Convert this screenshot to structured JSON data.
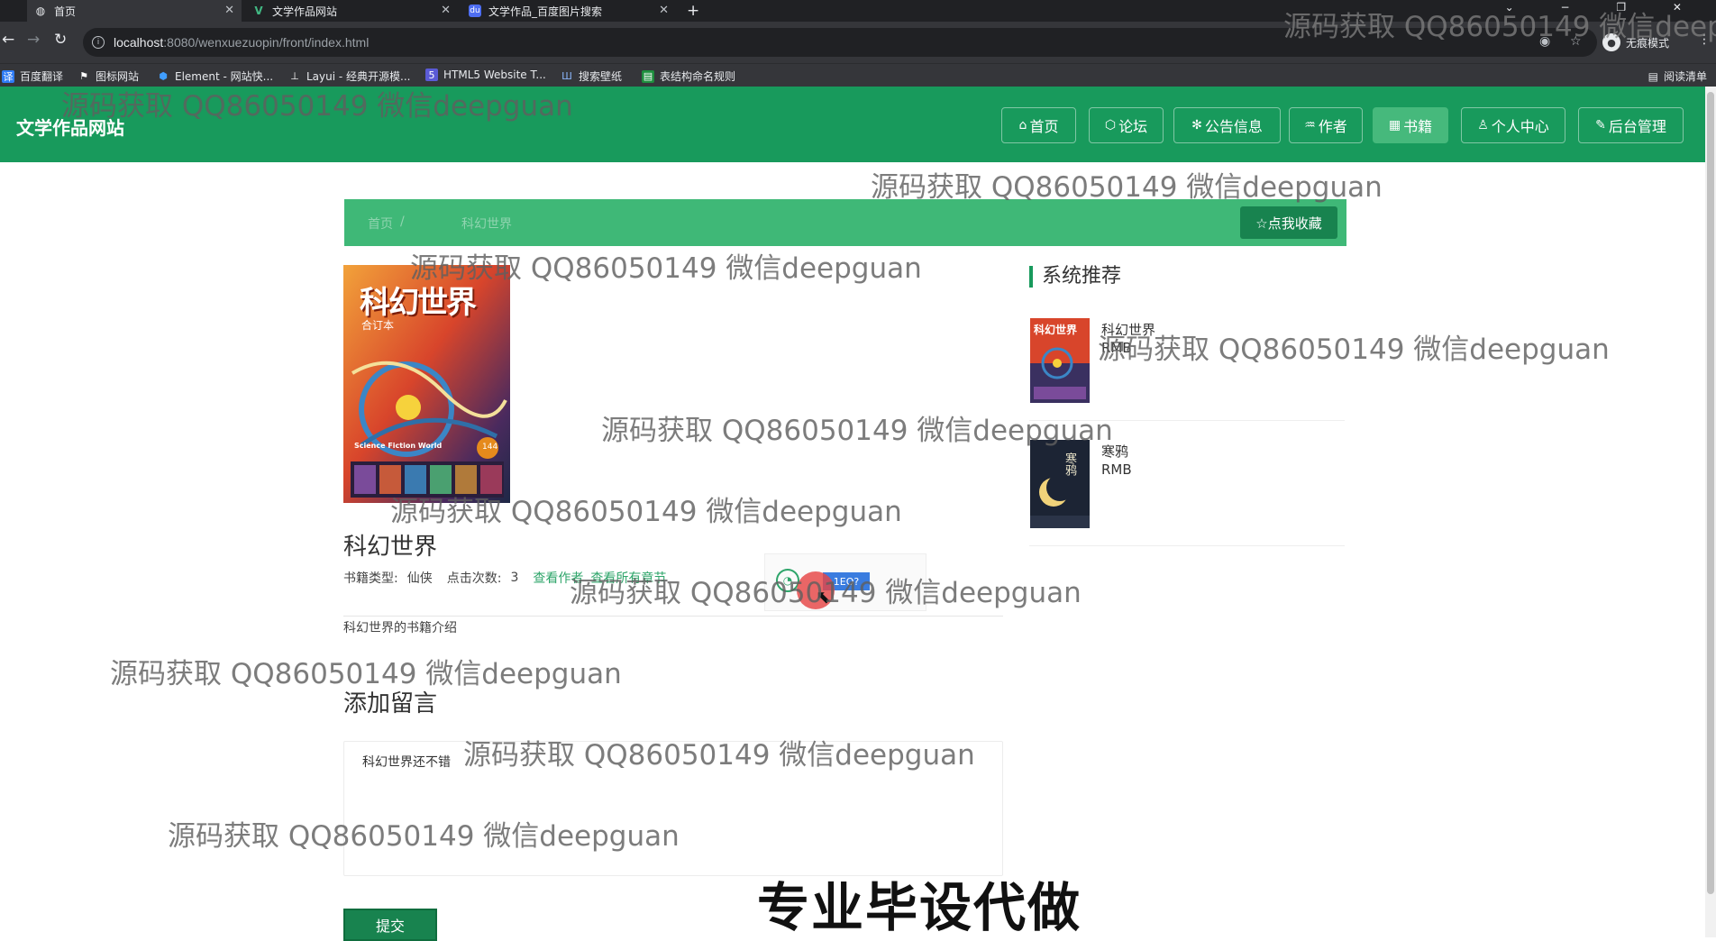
{
  "browser": {
    "tabs": [
      {
        "title": "首页",
        "active": true,
        "icon": "globe-icon"
      },
      {
        "title": "文学作品网站",
        "active": false,
        "icon": "vue-logo-icon"
      },
      {
        "title": "文学作品_百度图片搜索",
        "active": false,
        "icon": "baidu-icon"
      }
    ],
    "url_host": "localhost",
    "url_rest": ":8080/wenxuezuopin/front/index.html",
    "incognito_label": "无痕模式",
    "bookmarks": [
      {
        "label": "百度翻译",
        "icon": "translate-icon"
      },
      {
        "label": "图标网站",
        "icon": "flag-icon"
      },
      {
        "label": "Element - 网站快...",
        "icon": "element-icon"
      },
      {
        "label": "Layui - 经典开源模...",
        "icon": "layui-icon"
      },
      {
        "label": "HTML5 Website T...",
        "icon": "html5-icon"
      },
      {
        "label": "搜索壁纸",
        "icon": "wallpaper-icon"
      },
      {
        "label": "表结构命名规则",
        "icon": "table-icon"
      }
    ],
    "reading_list": "阅读清单"
  },
  "site": {
    "title": "文学作品网站",
    "nav": [
      {
        "label": "首页",
        "icon": "⌂",
        "active": false
      },
      {
        "label": "论坛",
        "icon": "⬡",
        "active": false
      },
      {
        "label": "公告信息",
        "icon": "✻",
        "active": false
      },
      {
        "label": "作者",
        "icon": "♒",
        "active": false
      },
      {
        "label": "书籍",
        "icon": "▦",
        "active": true
      },
      {
        "label": "个人中心",
        "icon": "♙",
        "active": false
      },
      {
        "label": "后台管理",
        "icon": "✎",
        "active": false
      }
    ]
  },
  "breadcrumb": {
    "home": "首页",
    "separator": "/",
    "current": "科幻世界"
  },
  "favorite_button": "☆点我收藏",
  "book": {
    "title": "科幻世界",
    "type_label": "书籍类型:",
    "type_value": "仙侠",
    "clicks_label": "点击次数:",
    "clicks_value": "3",
    "view_author_link": "查看作者",
    "view_chapters_link": "查看所有章节",
    "intro": "科幻世界的书籍介绍",
    "cover_title": "科幻世界",
    "cover_subtitle": "合订本",
    "cover_brand": "Science Fiction World",
    "cover_issue": "144"
  },
  "share": {
    "tag": "1EO?"
  },
  "comment": {
    "heading": "添加留言",
    "value": "科幻世界还不错",
    "submit": "提交"
  },
  "recommend": {
    "heading": "系统推荐",
    "items": [
      {
        "name": "科幻世界",
        "price": "RMB",
        "thumb_text": "科幻世界"
      },
      {
        "name": "寒鸦",
        "price": "RMB",
        "thumb_text": "寒鸦"
      }
    ]
  },
  "watermark": "源码获取 QQ86050149 微信deepguan",
  "promo": "专业毕设代做",
  "colors": {
    "primary": "#189a5c",
    "primary_light": "#3fb877",
    "primary_dark": "#18834f",
    "link": "#2ea56a"
  }
}
